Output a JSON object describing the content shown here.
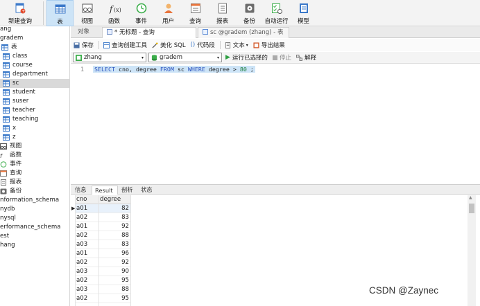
{
  "toolbar": {
    "items": [
      {
        "label": "新建查询",
        "icon": "new-query-icon"
      },
      {
        "label": "表",
        "icon": "table-icon"
      },
      {
        "label": "视图",
        "icon": "view-icon"
      },
      {
        "label": "函数",
        "icon": "function-icon"
      },
      {
        "label": "事件",
        "icon": "event-icon"
      },
      {
        "label": "用户",
        "icon": "user-icon"
      },
      {
        "label": "查询",
        "icon": "query-icon"
      },
      {
        "label": "报表",
        "icon": "report-icon"
      },
      {
        "label": "备份",
        "icon": "backup-icon"
      },
      {
        "label": "自动运行",
        "icon": "auto-run-icon"
      },
      {
        "label": "模型",
        "icon": "model-icon"
      }
    ],
    "active_index": 1
  },
  "sidebar": {
    "root_partial": "ang",
    "db_partial": "gradem",
    "tables_label": "表",
    "tables": [
      "class",
      "course",
      "department",
      "sc",
      "student",
      "suser",
      "teacher",
      "teaching",
      "x",
      "z"
    ],
    "selected_table": "sc",
    "groups": [
      "视图",
      "函数",
      "事件",
      "查询",
      "报表",
      "备份"
    ],
    "other_dbs": [
      "nformation_schema",
      "nydb",
      "nysql",
      "erformance_schema",
      "est",
      "hang"
    ]
  },
  "tabs": {
    "object_label": "对象",
    "query_tab": "* 无标题 - 查询",
    "table_tab": "sc @gradem (zhang) - 表"
  },
  "query_toolbar": {
    "save": "保存",
    "builder": "查询创建工具",
    "beautify": "美化 SQL",
    "snippet": "代码段",
    "text": "文本",
    "export": "导出结果"
  },
  "selector": {
    "connection": "zhang",
    "database": "gradem",
    "run_selected": "运行已选择的",
    "stop": "停止",
    "explain": "解释"
  },
  "editor": {
    "line_number": "1",
    "sql_parts": [
      {
        "t": "SELECT",
        "c": "kw"
      },
      {
        "t": " cno, degree ",
        "c": ""
      },
      {
        "t": "FROM",
        "c": "kw"
      },
      {
        "t": " sc ",
        "c": ""
      },
      {
        "t": "WHERE",
        "c": "kw"
      },
      {
        "t": " degree > ",
        "c": ""
      },
      {
        "t": "80",
        "c": "num"
      },
      {
        "t": " ;",
        "c": ""
      }
    ]
  },
  "result_tabs": [
    "信息",
    "Result 1",
    "剖析",
    "状态"
  ],
  "result_active": 1,
  "grid": {
    "columns": [
      "cno",
      "degree"
    ],
    "rows": [
      [
        "a01",
        "82"
      ],
      [
        "a02",
        "83"
      ],
      [
        "a01",
        "92"
      ],
      [
        "a02",
        "88"
      ],
      [
        "a03",
        "83"
      ],
      [
        "a01",
        "96"
      ],
      [
        "a02",
        "92"
      ],
      [
        "a03",
        "90"
      ],
      [
        "a02",
        "95"
      ],
      [
        "a03",
        "88"
      ],
      [
        "a02",
        "95"
      ]
    ],
    "selected_row": 0
  },
  "watermark": "CSDN @Zaynec",
  "colors": {
    "accent": "#cde4f7",
    "toolbar_bg": "#f3f3f3",
    "keyword": "#2a52be"
  }
}
